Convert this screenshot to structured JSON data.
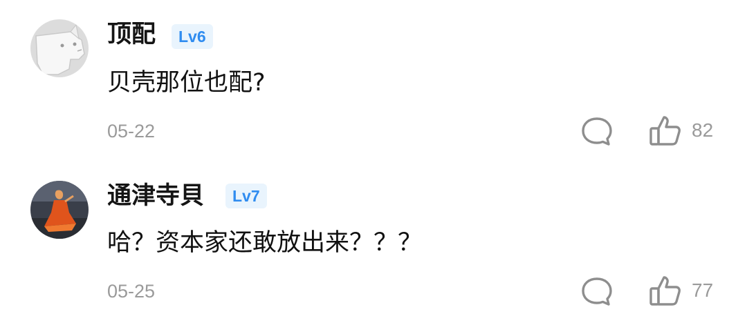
{
  "comments": [
    {
      "username": "顶配",
      "level": "Lv6",
      "content": "贝壳那位也配?",
      "date": "05-22",
      "likes": "82",
      "avatar_icon": "white-dog-avatar-icon"
    },
    {
      "username": "通津寺貝",
      "level": "Lv7",
      "content": "哈？资本家还敢放出来？？？",
      "date": "05-25",
      "likes": "77",
      "avatar_icon": "dancer-photo-avatar-icon"
    }
  ],
  "icons": {
    "reply": "comment-bubble-icon",
    "like": "thumbs-up-icon"
  },
  "colors": {
    "badge_bg": "#e9f4fd",
    "badge_text": "#2f8cf0",
    "meta_text": "#9a9a9a",
    "icon_stroke": "#8e8e8e"
  }
}
